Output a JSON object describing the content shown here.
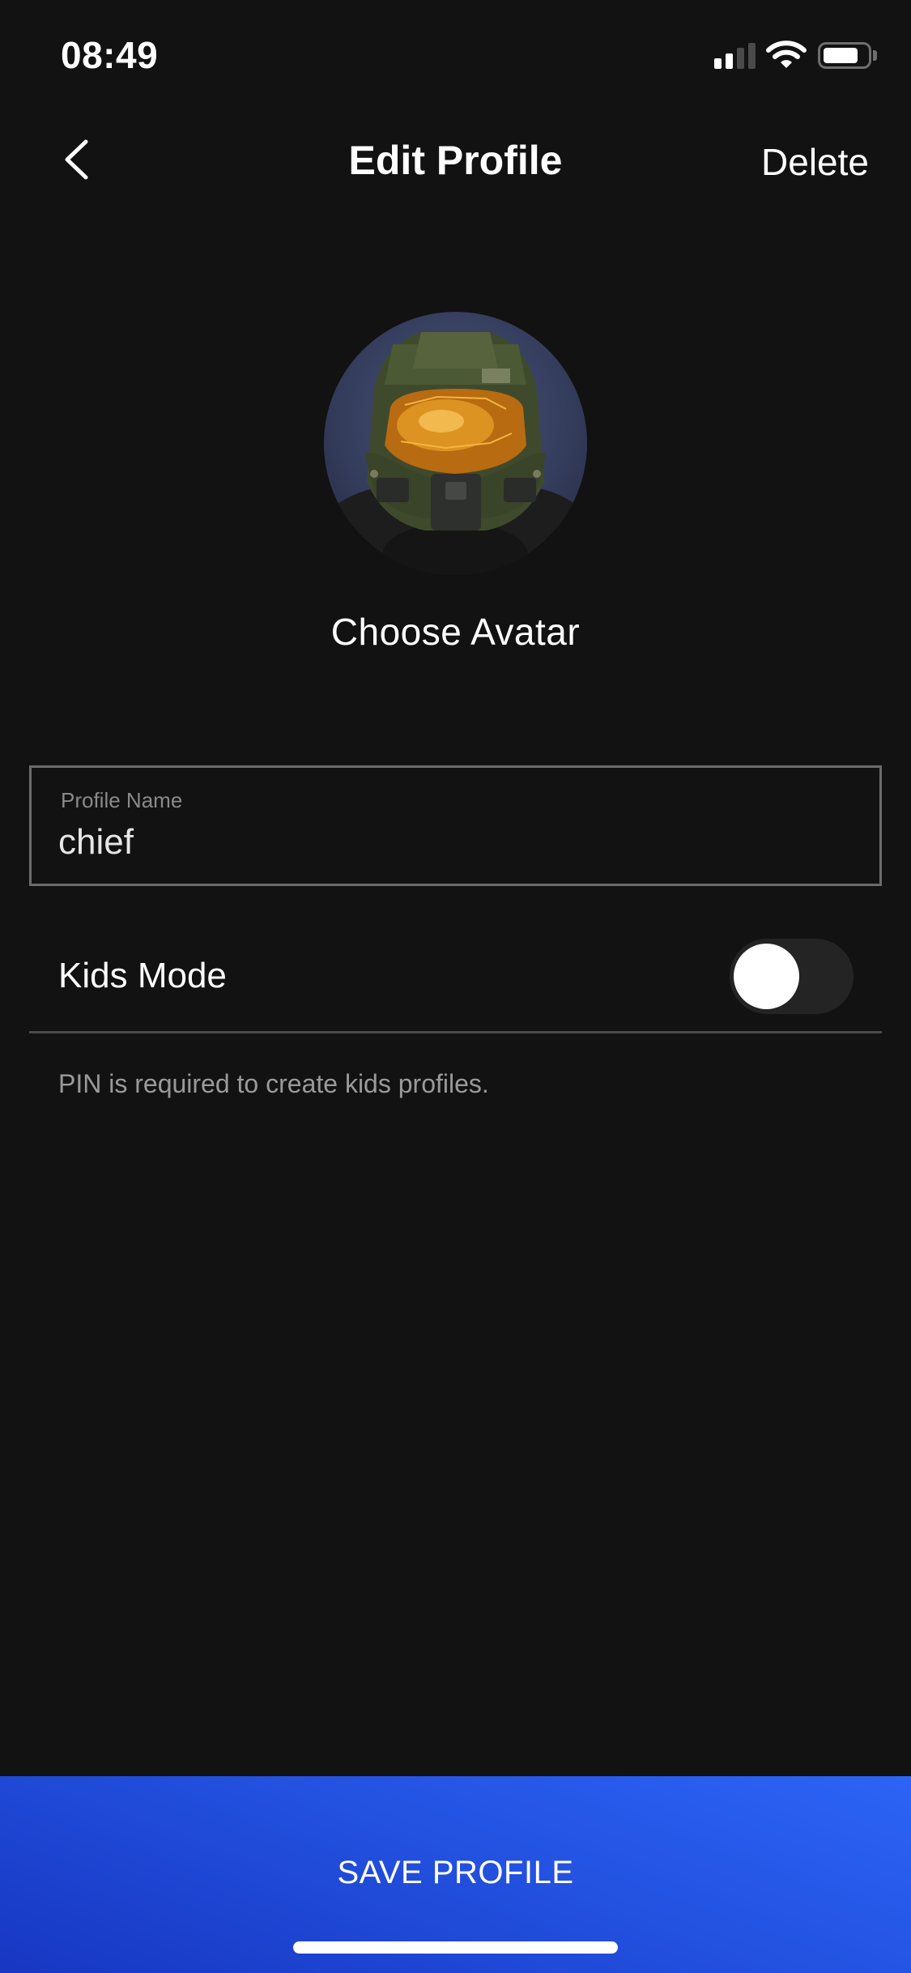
{
  "status_bar": {
    "time": "08:49",
    "signal_bars_active": 2,
    "signal_bars_total": 4,
    "battery_level": 0.8,
    "icons": [
      "signal-icon",
      "wifi-icon",
      "battery-icon"
    ]
  },
  "nav": {
    "back_icon": "chevron-left-icon",
    "title": "Edit Profile",
    "delete_label": "Delete"
  },
  "avatar": {
    "image_desc": "Master Chief helmet avatar",
    "choose_label": "Choose Avatar"
  },
  "profile_name": {
    "label": "Profile Name",
    "value": "chief"
  },
  "kids_mode": {
    "label": "Kids Mode",
    "enabled": false,
    "note": "PIN is required to create kids profiles."
  },
  "footer": {
    "save_label": "SAVE PROFILE"
  },
  "colors": {
    "background": "#121212",
    "accent_blue": "#2351e0"
  }
}
